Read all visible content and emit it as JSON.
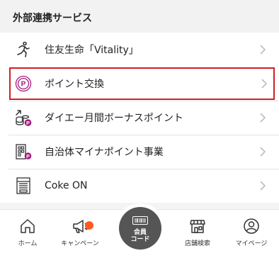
{
  "section": {
    "title": "外部連携サービス"
  },
  "rows": [
    {
      "label": "住友生命「Vitality」",
      "icon": "runner-icon"
    },
    {
      "label": "ポイント交換",
      "icon": "point-p-icon"
    },
    {
      "label": "ダイエー月間ボーナスポイント",
      "icon": "coins-point-icon"
    },
    {
      "label": "自治体マイナポイント事業",
      "icon": "building-point-icon"
    },
    {
      "label": "Coke ON",
      "icon": "vending-machine-icon"
    }
  ],
  "tabbar": {
    "home": "ホーム",
    "campaign": "キャンペーン",
    "member": "会員\nコード",
    "store_search": "店舗検索",
    "mypage": "マイページ"
  },
  "colors": {
    "highlight": "#d21f26",
    "point_purple": "#a0187c",
    "badge": "#ff5a1f",
    "member_button": "#555555"
  }
}
